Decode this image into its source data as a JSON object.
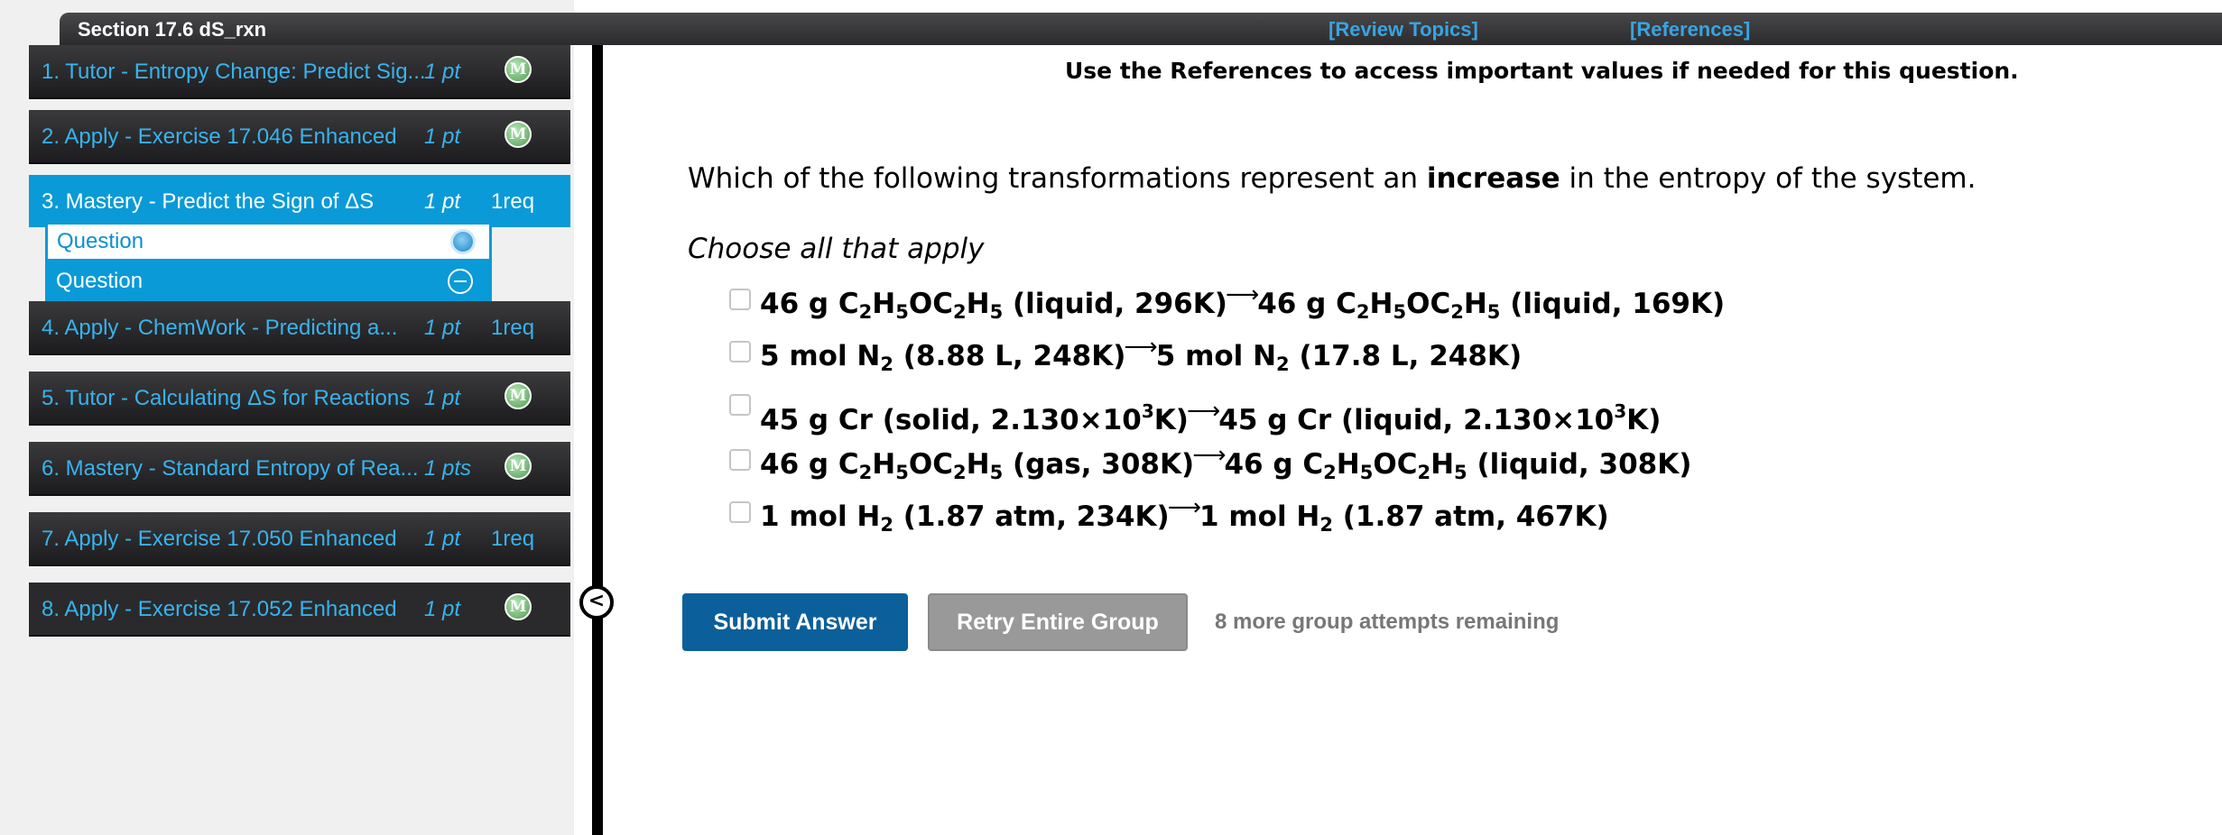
{
  "header": {
    "section_title": "Section 17.6 dS_rxn",
    "review_topics": "[Review Topics]",
    "references": "[References]"
  },
  "sidebar": {
    "items": [
      {
        "label": "1. Tutor - Entropy Change: Predict Sig...",
        "points": "1 pt",
        "badge": "M"
      },
      {
        "label": "2. Apply - Exercise 17.046 Enhanced",
        "points": "1 pt",
        "badge": "M"
      },
      {
        "label": "3. Mastery - Predict the Sign of ΔS",
        "points": "1 pt",
        "req": "1req"
      },
      {
        "label": "4. Apply - ChemWork - Predicting a...",
        "points": "1 pt",
        "req": "1req"
      },
      {
        "label": "5. Tutor - Calculating ΔS for Reactions",
        "points": "1 pt",
        "badge": "M"
      },
      {
        "label": "6. Mastery - Standard Entropy of Rea...",
        "points": "1 pts",
        "badge": "M"
      },
      {
        "label": "7. Apply - Exercise 17.050 Enhanced",
        "points": "1 pt",
        "req": "1req"
      },
      {
        "label": "8. Apply - Exercise 17.052 Enhanced",
        "points": "1 pt",
        "badge": "M"
      }
    ],
    "sub_questions": [
      "Question",
      "Question"
    ],
    "collapse_glyph": "<"
  },
  "main": {
    "references_note": "Use the References to access important values if needed for this question.",
    "question_pre": "Which of the following transformations represent an ",
    "question_bold": "increase",
    "question_post": " in the entropy of the system.",
    "instruction": "Choose all that apply",
    "options": [
      {
        "parts": [
          {
            "t": "46 g C"
          },
          {
            "sub": "2"
          },
          {
            "t": "H"
          },
          {
            "sub": "5"
          },
          {
            "t": "OC"
          },
          {
            "sub": "2"
          },
          {
            "t": "H"
          },
          {
            "sub": "5"
          },
          {
            "t": " (liquid, 296K)"
          },
          {
            "arrow": true
          },
          {
            "t": "46 g C"
          },
          {
            "sub": "2"
          },
          {
            "t": "H"
          },
          {
            "sub": "5"
          },
          {
            "t": "OC"
          },
          {
            "sub": "2"
          },
          {
            "t": "H"
          },
          {
            "sub": "5"
          },
          {
            "t": " (liquid, 169K)"
          }
        ]
      },
      {
        "parts": [
          {
            "t": "5 mol N"
          },
          {
            "sub": "2"
          },
          {
            "t": " (8.88 L, 248K)"
          },
          {
            "arrow": true
          },
          {
            "t": "5 mol N"
          },
          {
            "sub": "2"
          },
          {
            "t": " (17.8 L, 248K)"
          }
        ]
      },
      {
        "parts": [
          {
            "t": "45 g Cr (solid, 2.130×10"
          },
          {
            "sup": "3"
          },
          {
            "t": "K)"
          },
          {
            "arrow": true
          },
          {
            "t": "45 g Cr (liquid, 2.130×10"
          },
          {
            "sup": "3"
          },
          {
            "t": "K)"
          }
        ]
      },
      {
        "parts": [
          {
            "t": "46 g C"
          },
          {
            "sub": "2"
          },
          {
            "t": "H"
          },
          {
            "sub": "5"
          },
          {
            "t": "OC"
          },
          {
            "sub": "2"
          },
          {
            "t": "H"
          },
          {
            "sub": "5"
          },
          {
            "t": " (gas, 308K)"
          },
          {
            "arrow": true
          },
          {
            "t": "46 g C"
          },
          {
            "sub": "2"
          },
          {
            "t": "H"
          },
          {
            "sub": "5"
          },
          {
            "t": "OC"
          },
          {
            "sub": "2"
          },
          {
            "t": "H"
          },
          {
            "sub": "5"
          },
          {
            "t": " (liquid, 308K)"
          }
        ]
      },
      {
        "parts": [
          {
            "t": "1 mol H"
          },
          {
            "sub": "2"
          },
          {
            "t": " (1.87 atm, 234K)"
          },
          {
            "arrow": true
          },
          {
            "t": "1 mol H"
          },
          {
            "sub": "2"
          },
          {
            "t": " (1.87 atm, 467K)"
          }
        ]
      }
    ],
    "arrow_glyph": "⟶",
    "submit_label": "Submit Answer",
    "retry_label": "Retry Entire Group",
    "attempts_text": "8 more group attempts remaining"
  },
  "colors": {
    "sidebar_link": "#38b3ee",
    "active_item": "#0a9ad8",
    "submit_button": "#0b5f9a",
    "retry_button": "#999999"
  }
}
